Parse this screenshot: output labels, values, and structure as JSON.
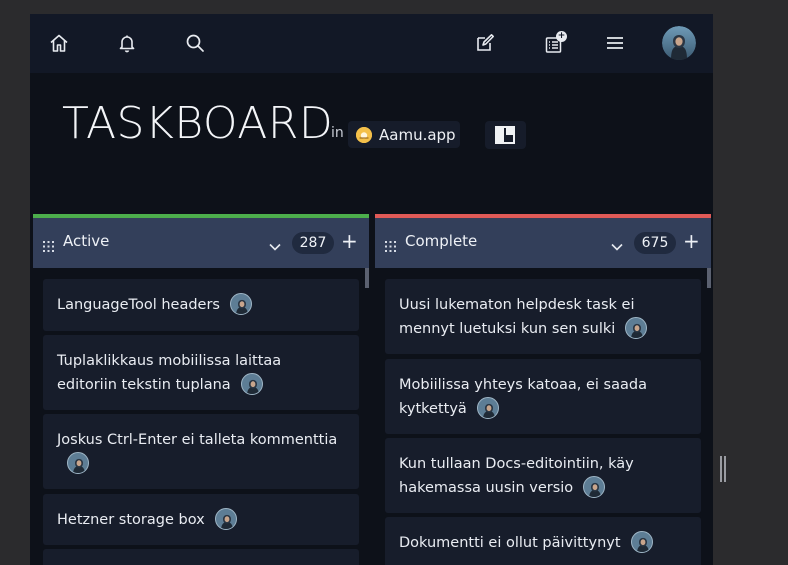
{
  "app": {
    "title": "TASKBOARD",
    "in_label": "in",
    "workspace": "Aamu.app"
  },
  "topbar": {
    "icons": [
      "home-icon",
      "bell-icon",
      "search-icon",
      "edit-icon",
      "tasklist-icon",
      "menu-icon",
      "avatar"
    ],
    "tasklist_badge": "+"
  },
  "columns": [
    {
      "name": "Active",
      "count": "287",
      "accent": "#4cae4c",
      "cards": [
        {
          "text": "LanguageTool headers"
        },
        {
          "text": "Tuplaklikkaus mobiilissa laittaa editoriin tekstin tuplana"
        },
        {
          "text": "Joskus Ctrl-Enter ei talleta kommenttia"
        },
        {
          "text": "Hetzner storage box"
        },
        {
          "text": ""
        }
      ]
    },
    {
      "name": "Complete",
      "count": "675",
      "accent": "#e05a57",
      "cards": [
        {
          "text": "Uusi lukematon helpdesk task ei mennyt luetuksi kun sen sulki"
        },
        {
          "text": "Mobiilissa yhteys katoaa, ei saada kytkettyä"
        },
        {
          "text": "Kun tullaan Docs-editointiin, käy hakemassa uusin versio"
        },
        {
          "text": "Dokumentti ei ollut päivittynyt"
        }
      ]
    }
  ],
  "colors": {
    "background": "#0d1119",
    "topbar": "#121826",
    "column_header": "#333f5a",
    "card": "#171d2b"
  }
}
